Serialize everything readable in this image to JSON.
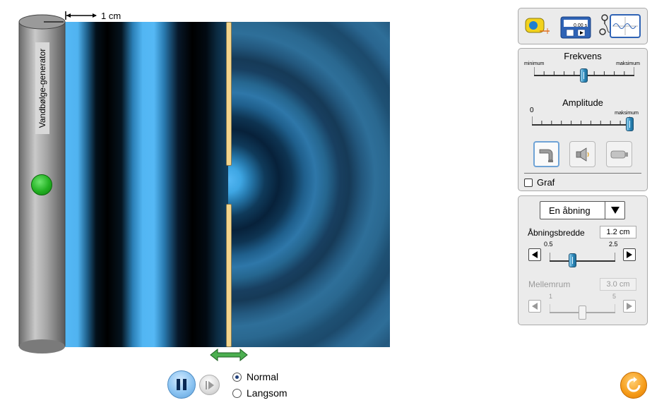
{
  "measure": {
    "label": "1 cm"
  },
  "generator": {
    "label": "Vandbølge-generator"
  },
  "playback": {
    "speed_options": [
      {
        "label": "Normal",
        "selected": true
      },
      {
        "label": "Langsom",
        "selected": false
      }
    ]
  },
  "tools": {
    "stopwatch_readout": "0.00 s"
  },
  "frequency": {
    "title": "Frekvens",
    "min_label": "minimum",
    "max_label": "maksimum",
    "level": 0.5
  },
  "amplitude": {
    "title": "Amplitude",
    "min_label": "0",
    "max_label": "maksimum",
    "level": 1.0
  },
  "sources": [
    {
      "icon": "faucet-icon",
      "selected": true
    },
    {
      "icon": "speaker-icon",
      "selected": false
    },
    {
      "icon": "laser-icon",
      "selected": false
    }
  ],
  "graph": {
    "label": "Graf",
    "checked": false
  },
  "barrier": {
    "mode_value": "En åbning",
    "slit_width_label": "Åbningsbredde",
    "slit_width_value": "1.2 cm",
    "slit_width_min": "0.5",
    "slit_width_max": "2.5",
    "slit_width": 1.2,
    "separation_label": "Mellemrum",
    "separation_value": "3.0 cm",
    "separation_min": "1",
    "separation_max": "5",
    "separation": 3.0
  },
  "colors": {
    "wave_light": "#55b8f5",
    "wave_dark": "#000000",
    "barrier": "#f3d58c",
    "generator_button": "#22b022",
    "reset": "#f59a17"
  }
}
